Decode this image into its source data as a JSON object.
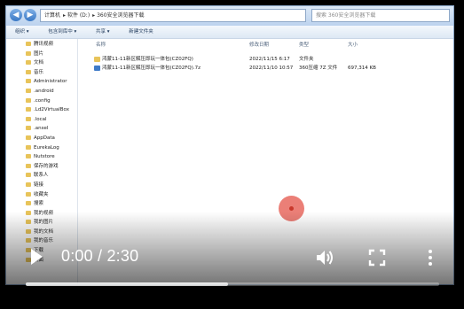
{
  "explorer": {
    "address_parts": [
      "计算机",
      "软件 (D:)",
      "360安全浏览器下载"
    ],
    "search_placeholder": "搜索 360安全浏览器下载",
    "toolbar": [
      "组织 ▾",
      "包含到库中 ▾",
      "共享 ▾",
      "新建文件夹"
    ],
    "columns": [
      "名称",
      "修改日期",
      "类型",
      "大小"
    ],
    "tree": [
      "腾讯视频",
      "图片",
      "文档",
      "音乐",
      "Administrator",
      ".android",
      ".config",
      ".Ld2VirtualBox",
      ".local",
      ".ansel",
      "AppData",
      "EurekaLog",
      "Nutstore",
      "保存的游戏",
      "联系人",
      "链接",
      "收藏夹",
      "搜索",
      "我的视频",
      "我的图片",
      "我的文档",
      "我的音乐",
      "下载",
      "桌面"
    ],
    "files": [
      {
        "name": "鸿蒙11-11新区解压即玩一体包(CZ02FQ)",
        "date": "2022/11/15 6:17",
        "type": "文件夹",
        "size": "",
        "kind": "folder"
      },
      {
        "name": "鸿蒙11-11新区解压即玩一体包(CZ02FQ).7z",
        "date": "2022/11/10 10:57",
        "type": "360压缩 7Z 文件",
        "size": "697,314 KB",
        "kind": "archive"
      }
    ]
  },
  "player": {
    "current_time": "0:00",
    "separator": "/",
    "duration": "2:30",
    "progress": 0.49,
    "accent": "#ffffff"
  }
}
